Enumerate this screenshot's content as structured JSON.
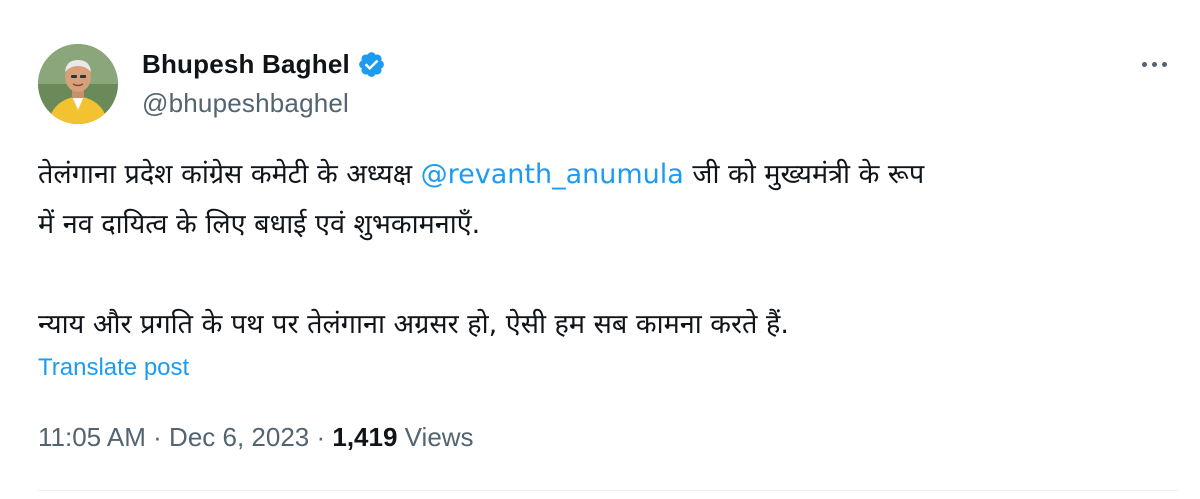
{
  "author": {
    "display_name": "Bhupesh Baghel",
    "handle": "@bhupeshbaghel",
    "verified": true
  },
  "post": {
    "text_line1_before": "तेलंगाना प्रदेश कांग्रेस कमेटी के अध्यक्ष ",
    "mention": "@revanth_anumula",
    "text_line1_after": " जी को मुख्यमंत्री के रूप",
    "text_line2": "में नव दायित्व के लिए बधाई एवं शुभकामनाएँ.",
    "text_para2": "न्याय और प्रगति के पथ पर तेलंगाना अग्रसर हो, ऐसी हम सब कामना करते हैं."
  },
  "translate_label": "Translate post",
  "meta": {
    "time": "11:05 AM",
    "separator": " · ",
    "date": "Dec 6, 2023",
    "views_count": "1,419",
    "views_label": " Views"
  },
  "colors": {
    "link": "#1d9bf0",
    "secondary_text": "#536471",
    "primary_text": "#0f1419"
  },
  "icons": {
    "verified": "verified-badge-icon",
    "more": "more-options-icon"
  }
}
